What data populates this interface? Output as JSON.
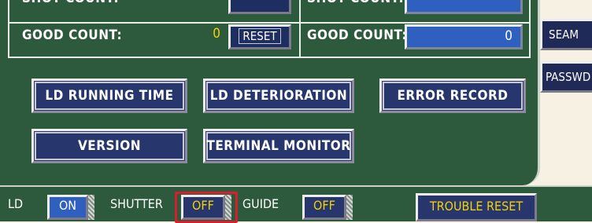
{
  "counts": {
    "top_left_label": "SHOT COUNT:",
    "top_right_label": "SHOT COUNT:",
    "left_good_label": "GOOD COUNT:",
    "left_good_value": "0",
    "reset_label": "RESET",
    "right_good_label": "GOOD COUNT:",
    "right_good_value": "0"
  },
  "menu": {
    "ld_running_time": "LD RUNNING TIME",
    "ld_deterioration": "LD DETERIORATION",
    "error_record": "ERROR RECORD",
    "version": "VERSION",
    "terminal_monitor": "TERMINAL MONITOR"
  },
  "side": {
    "seam": "SEAM",
    "passwd": "PASSWD"
  },
  "status": {
    "ld_label": "LD",
    "ld_state": "ON",
    "shutter_label": "SHUTTER",
    "shutter_state": "OFF",
    "guide_label": "GUIDE",
    "guide_state": "OFF",
    "trouble_reset": "TROUBLE RESET"
  },
  "colors": {
    "panel_green": "#2d5a3c",
    "button_navy": "#27376e",
    "value_blue": "#2f60c0",
    "highlight_red": "#d61f2c",
    "value_yellow": "#f2d200"
  }
}
